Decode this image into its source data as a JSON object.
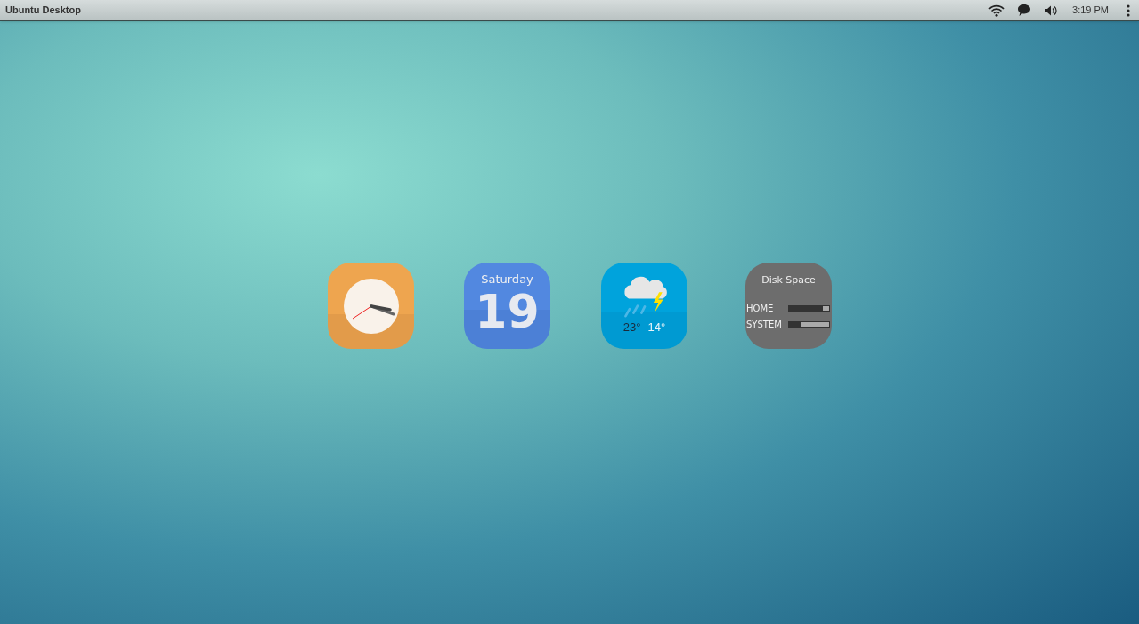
{
  "top_bar": {
    "title": "Ubuntu Desktop",
    "clock": "3:19 PM"
  },
  "calendar": {
    "weekday": "Saturday",
    "day": "19"
  },
  "weather": {
    "high": "23°",
    "low": "14°"
  },
  "disk_space": {
    "title": "Disk Space",
    "drives": [
      {
        "label": "HOME",
        "level": 0.85
      },
      {
        "label": "SYSTEM",
        "level": 0.3
      }
    ]
  }
}
